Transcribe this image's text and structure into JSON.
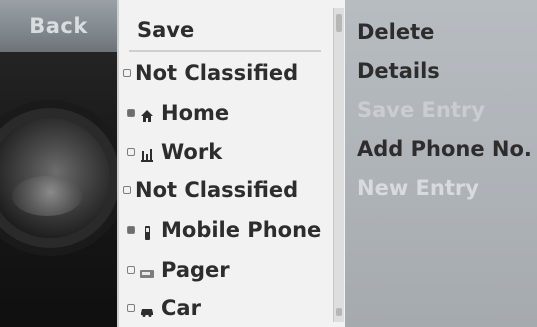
{
  "left": {
    "back_label": "Back"
  },
  "middle": {
    "save_label": "Save",
    "items": [
      {
        "label": "Not Classified",
        "bullet": "outline",
        "icon": ""
      },
      {
        "label": "Home",
        "bullet": "filled",
        "icon": "house-icon"
      },
      {
        "label": "Work",
        "bullet": "outline",
        "icon": "briefcase-icon"
      },
      {
        "label": "Not Classified",
        "bullet": "outline",
        "icon": ""
      },
      {
        "label": "Mobile Phone",
        "bullet": "filled",
        "icon": "mobile-phone-icon"
      },
      {
        "label": "Pager",
        "bullet": "outline",
        "icon": "pager-icon"
      },
      {
        "label": "Car",
        "bullet": "outline",
        "icon": "car-icon"
      }
    ]
  },
  "right": {
    "items": [
      {
        "label": "Delete",
        "enabled": true
      },
      {
        "label": "Details",
        "enabled": true
      },
      {
        "label": "Save Entry",
        "enabled": false
      },
      {
        "label": "Add Phone No.",
        "enabled": true
      },
      {
        "label": "New Entry",
        "enabled": false
      }
    ]
  },
  "colors": {
    "panel_bg": "#b7bcc1",
    "list_bg": "#f2f2f2",
    "text": "#2d2d2d",
    "disabled_text": "#d7dade",
    "back_button_bg": "#8c9298"
  }
}
